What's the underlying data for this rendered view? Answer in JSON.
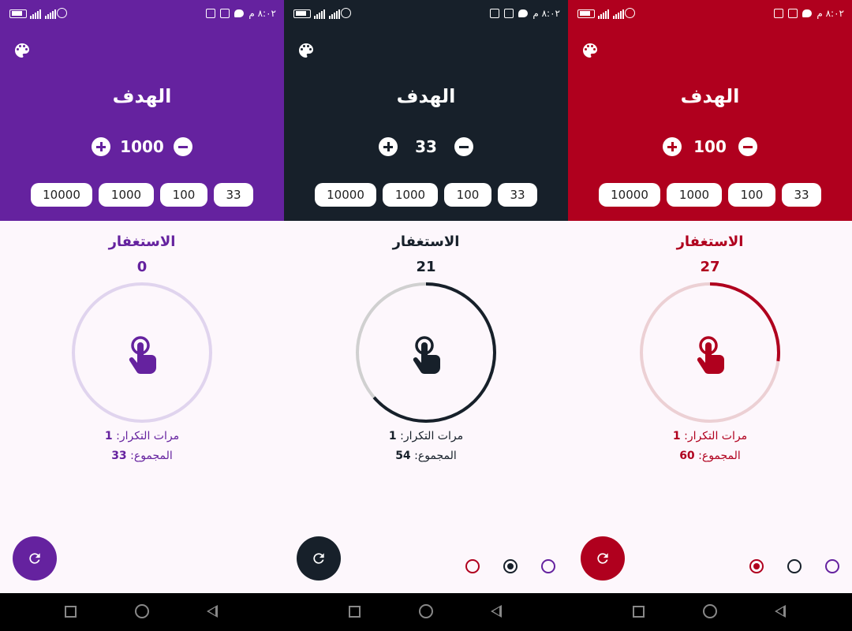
{
  "status_bar": {
    "time": "٨:٠٢ م"
  },
  "screens": [
    {
      "theme": {
        "primary": "#65229f",
        "track": "#e0d4ee"
      },
      "goal_title": "الهدف",
      "goal_value": "1000",
      "presets": [
        "10000",
        "1000",
        "100",
        "33"
      ],
      "dhikr_name": "الاستغفار",
      "count": "0",
      "progress_fraction": 0.0,
      "repetitions_label": "مرات التكرار:",
      "repetitions_value": "1",
      "total_label": "المجموع:",
      "total_value": "33",
      "show_theme_selector": false,
      "theme_selector": []
    },
    {
      "theme": {
        "primary": "#17202a",
        "track": "#d0d0d0"
      },
      "goal_title": "الهدف",
      "goal_value": "33",
      "presets": [
        "10000",
        "1000",
        "100",
        "33"
      ],
      "dhikr_name": "الاستغفار",
      "count": "21",
      "progress_fraction": 0.6364,
      "repetitions_label": "مرات التكرار:",
      "repetitions_value": "1",
      "total_label": "المجموع:",
      "total_value": "54",
      "show_theme_selector": true,
      "theme_selector": [
        {
          "color": "#b0001e",
          "selected": false
        },
        {
          "color": "#17202a",
          "selected": true
        },
        {
          "color": "#65229f",
          "selected": false
        }
      ]
    },
    {
      "theme": {
        "primary": "#b0001e",
        "track": "#ecd0d4"
      },
      "goal_title": "الهدف",
      "goal_value": "100",
      "presets": [
        "10000",
        "1000",
        "100",
        "33"
      ],
      "dhikr_name": "الاستغفار",
      "count": "27",
      "progress_fraction": 0.27,
      "repetitions_label": "مرات التكرار:",
      "repetitions_value": "1",
      "total_label": "المجموع:",
      "total_value": "60",
      "show_theme_selector": true,
      "theme_selector": [
        {
          "color": "#b0001e",
          "selected": true
        },
        {
          "color": "#17202a",
          "selected": false
        },
        {
          "color": "#65229f",
          "selected": false
        }
      ]
    }
  ],
  "icons": {
    "palette": "palette-icon",
    "plus": "plus-icon",
    "minus": "minus-icon",
    "tap": "touch-app-icon",
    "reset": "refresh-icon",
    "nav_recents": "square-icon",
    "nav_home": "circle-icon",
    "nav_back": "triangle-back-icon"
  }
}
